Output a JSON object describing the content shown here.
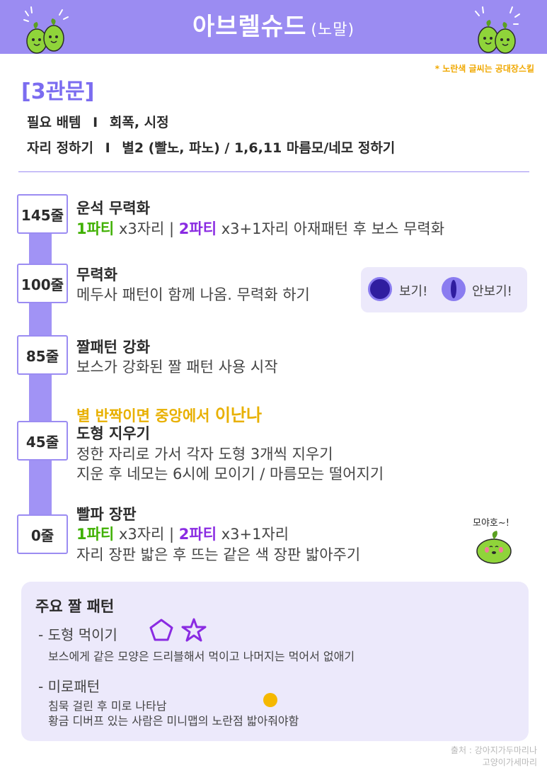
{
  "header": {
    "title": "아브렐슈드",
    "subtitle": "(노말)"
  },
  "note": "* 노란색 글씨는 공대장스킬",
  "section_title": "[3관문]",
  "info": {
    "items_label": "필요 배템",
    "items_value": "회폭, 시정",
    "position_label": "자리 정하기",
    "position_value": "별2 (빨노, 파노) / 1,6,11 마름모/네모 정하기",
    "separator": "I"
  },
  "phases": [
    {
      "lines": "145줄",
      "title": "운석 무력화",
      "party1": "1파티",
      "party1_text": " x3자리 | ",
      "party2": "2파티",
      "party2_text": " x3+1자리 아재패턴 후 보스 무력화"
    },
    {
      "lines": "100줄",
      "title": "무력화",
      "text": "메두사 패턴이 함께 나옴. 무력화 하기"
    },
    {
      "lines": "85줄",
      "title": "짤패턴 강화",
      "text": "보스가 강화된 짤 패턴 사용 시작"
    },
    {
      "lines": "45줄",
      "leader_prefix": "별 반짝이면 중앙에서 ",
      "leader_strong": "이난나",
      "title": "도형 지우기",
      "text1": "정한 자리로 가서 각자 도형 3개씩 지우기",
      "text2": "지운 후 네모는 6시에 모이기 / 마름모는 떨어지기"
    },
    {
      "lines": "0줄",
      "title": "빨파 장판",
      "party1": "1파티",
      "party1_text": " x3자리 | ",
      "party2": "2파티",
      "party2_text": " x3+1자리",
      "text": "자리 장판 밟은 후 뜨는 같은 색 장판 밟아주기"
    }
  ],
  "eyes": {
    "look": "보기!",
    "dont_look": "안보기!"
  },
  "mascot_speech": "모야호~!",
  "summary": {
    "title": "주요 짤 패턴",
    "item1_title": "- 도형 먹이기",
    "item1_text": "보스에게 같은 모양은 드리블해서 먹이고 나머지는 먹어서 없애기",
    "item2_title": "- 미로패턴",
    "item2_text1": "침묵 걸린 후 미로 나타남",
    "item2_text2": "황금 디버프 있는 사람은 미니맵의 노란점 밟아줘야함"
  },
  "source": {
    "line1": "출처 : 강아지가두마리나",
    "line2": "고양이가세마리"
  },
  "colors": {
    "accent": "#9b8cf2",
    "green": "#3fb000",
    "purple": "#8a2be2",
    "yellow": "#e8b000"
  }
}
